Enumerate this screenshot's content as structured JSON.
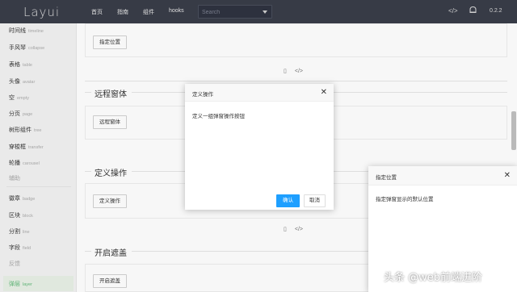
{
  "header": {
    "logo": "Layui",
    "nav": [
      "首页",
      "指南",
      "组件",
      "hooks"
    ],
    "search_placeholder": "Search",
    "icons": [
      "code-icon",
      "notification-icon"
    ],
    "version": "0.2.2"
  },
  "sidebar": {
    "items": [
      {
        "label": "时间线",
        "en": "timeline"
      },
      {
        "label": "手风琴",
        "en": "collapse"
      },
      {
        "label": "表格",
        "en": "table"
      },
      {
        "label": "头像",
        "en": "avatar"
      },
      {
        "label": "空",
        "en": "empty"
      },
      {
        "label": "分页",
        "en": "page"
      },
      {
        "label": "树形组件",
        "en": "tree"
      },
      {
        "label": "穿梭框",
        "en": "transfer"
      },
      {
        "label": "轮播",
        "en": "carousel"
      },
      {
        "label": "辅助",
        "en": ""
      },
      {
        "label": "徽章",
        "en": "badge"
      },
      {
        "label": "区块",
        "en": "block"
      },
      {
        "label": "分割",
        "en": "line"
      },
      {
        "label": "字段",
        "en": "field"
      },
      {
        "label": "反馈",
        "en": ""
      },
      {
        "label": "弹层",
        "en": "layer"
      }
    ]
  },
  "main": {
    "top_button": "指定位置",
    "sections": [
      {
        "title": "远程窗体",
        "button": "远程窗体"
      },
      {
        "title": "定义操作",
        "button": "定义操作"
      },
      {
        "title": "开启遮盖",
        "button": "开启遮盖"
      }
    ]
  },
  "modal_actions": {
    "title": "定义操作",
    "content": "定义一组弹窗操作按钮",
    "confirm": "确认",
    "cancel": "取消"
  },
  "modal_position": {
    "title": "指定位置",
    "content": "指定弹窗显示的默认位置"
  },
  "watermark": "头条 @web前端进阶"
}
